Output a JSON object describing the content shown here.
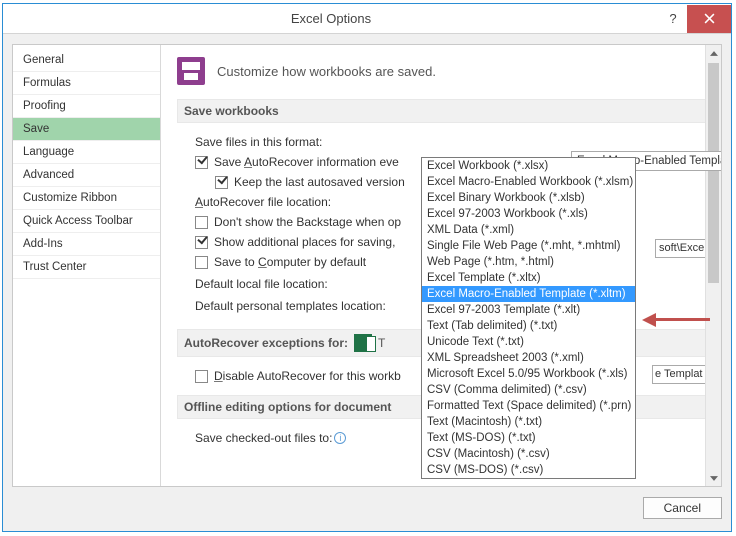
{
  "window": {
    "title": "Excel Options"
  },
  "sidebar": {
    "items": [
      "General",
      "Formulas",
      "Proofing",
      "Save",
      "Language",
      "Advanced",
      "Customize Ribbon",
      "Quick Access Toolbar",
      "Add-Ins",
      "Trust Center"
    ],
    "selected_index": 3
  },
  "header": {
    "text": "Customize how workbooks are saved."
  },
  "sections": {
    "save_workbooks": "Save workbooks",
    "autorecover_exceptions": "AutoRecover exceptions for:",
    "offline": "Offline editing options for document"
  },
  "labels": {
    "save_format": "Save files in this format:",
    "save_autorecover_prefix": "Save ",
    "save_autorecover_u": "A",
    "save_autorecover_rest": "utoRecover information eve",
    "keep_last_autosaved": "Keep the last autosaved version",
    "autorecover_file_loc_u": "A",
    "autorecover_file_loc_rest": "utoRecover file location:",
    "dont_show_backstage": "Don't show the Backstage when op",
    "show_additional": "Show additional places for saving,",
    "save_to_computer_prefix": "Save to ",
    "save_to_computer_u": "C",
    "save_to_computer_rest": "omputer by default",
    "default_local": "Default local file location:",
    "default_personal_tmpl": "Default personal templates location:",
    "disable_prefix": "",
    "disable_u": "D",
    "disable_rest": "isable AutoRecover for this workb",
    "save_checked_out": "Save checked-out files to:"
  },
  "combo": {
    "value": "Excel Macro-Enabled Template (*.xltm)"
  },
  "file_loc_value": "soft\\Excel\\",
  "tmpl_value": "e Templat",
  "dropdown": {
    "items": [
      "Excel Workbook (*.xlsx)",
      "Excel Macro-Enabled Workbook (*.xlsm)",
      "Excel Binary Workbook (*.xlsb)",
      "Excel 97-2003 Workbook (*.xls)",
      "XML Data (*.xml)",
      "Single File Web Page (*.mht, *.mhtml)",
      "Web Page (*.htm, *.html)",
      "Excel Template (*.xltx)",
      "Excel Macro-Enabled Template (*.xltm)",
      "Excel 97-2003 Template (*.xlt)",
      "Text (Tab delimited) (*.txt)",
      "Unicode Text (*.txt)",
      "XML Spreadsheet 2003 (*.xml)",
      "Microsoft Excel 5.0/95 Workbook (*.xls)",
      "CSV (Comma delimited) (*.csv)",
      "Formatted Text (Space delimited) (*.prn)",
      "Text (Macintosh) (*.txt)",
      "Text (MS-DOS) (*.txt)",
      "CSV (Macintosh) (*.csv)",
      "CSV (MS-DOS) (*.csv)"
    ],
    "highlighted_index": 8
  },
  "buttons": {
    "cancel": "Cancel"
  },
  "exception_combo": "T"
}
